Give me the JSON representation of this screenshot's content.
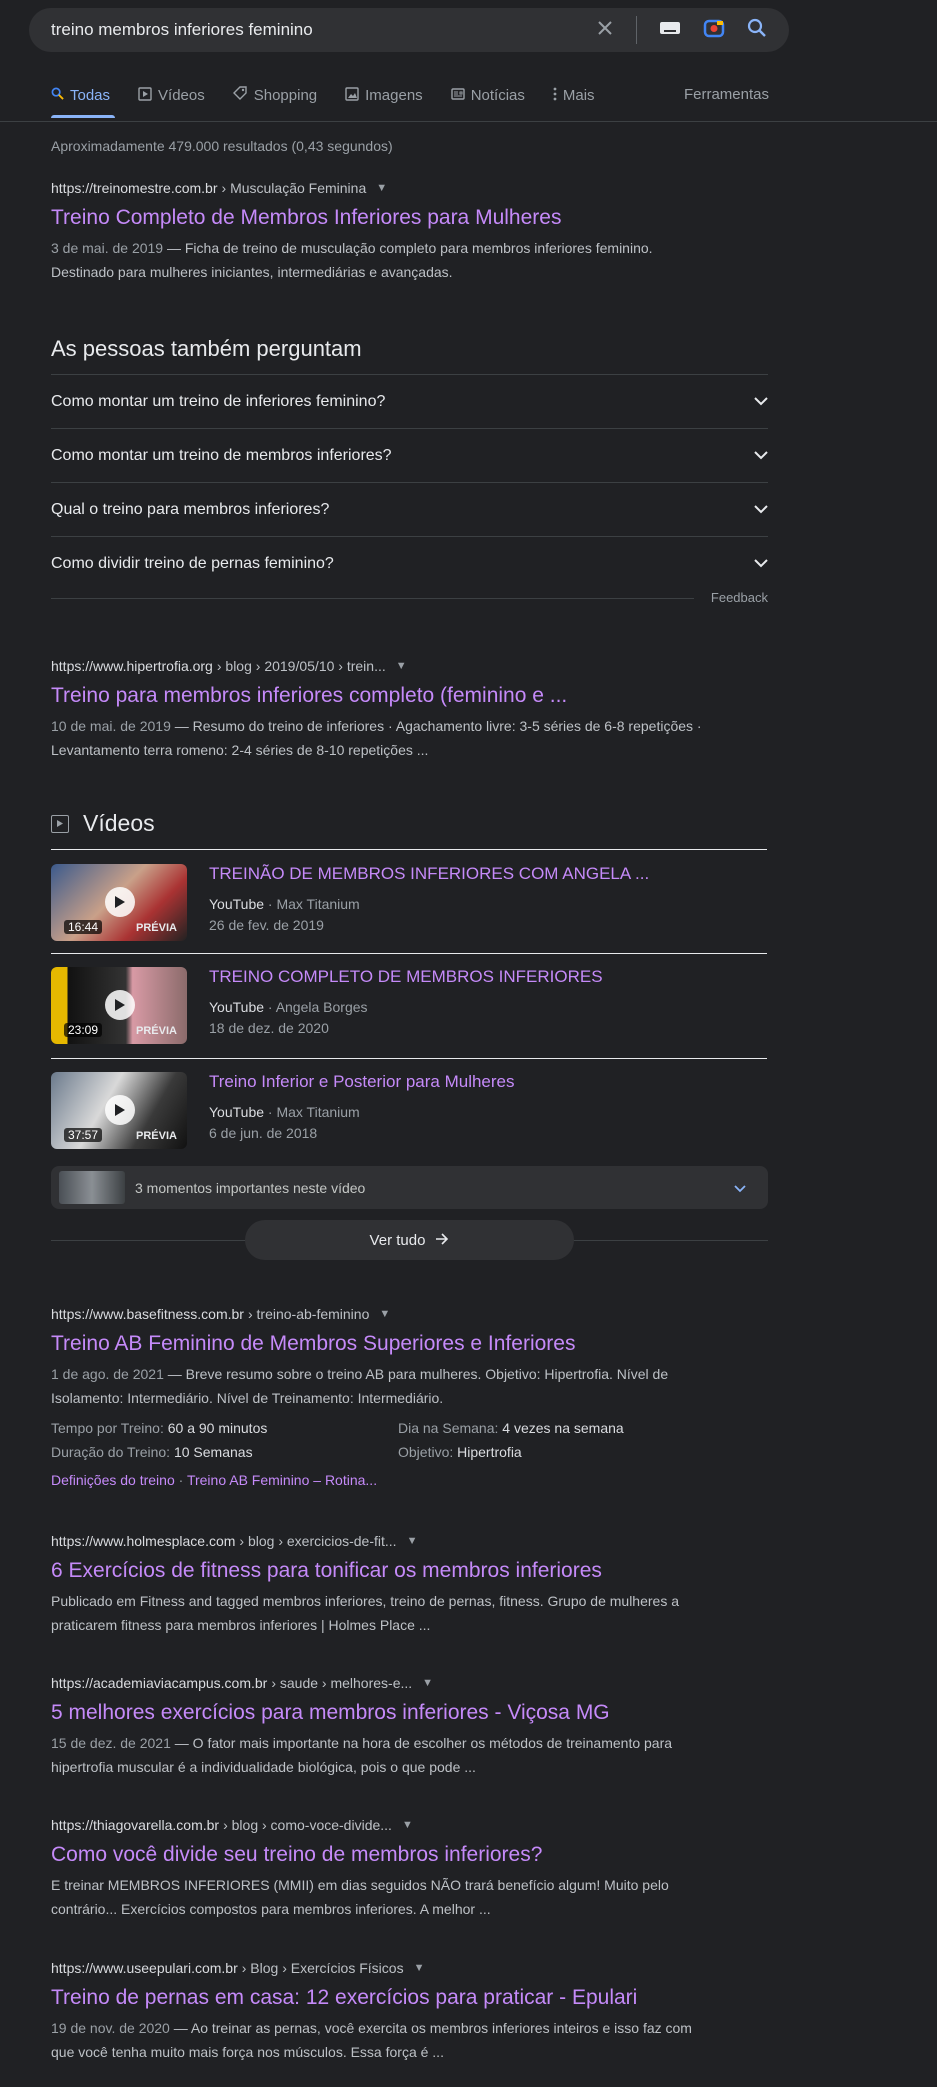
{
  "search": {
    "query": "treino membros inferiores feminino"
  },
  "tabs": [
    {
      "label": "Todas",
      "icon": "search-icon"
    },
    {
      "label": "Vídeos",
      "icon": "video-icon"
    },
    {
      "label": "Shopping",
      "icon": "tag-icon"
    },
    {
      "label": "Imagens",
      "icon": "image-icon"
    },
    {
      "label": "Notícias",
      "icon": "news-icon"
    },
    {
      "label": "Mais",
      "icon": "more-icon"
    }
  ],
  "tools_label": "Ferramentas",
  "stats": "Aproximadamente 479.000 resultados (0,43 segundos)",
  "results": [
    {
      "site": "https://treinomestre.com.br",
      "path": "› Musculação Feminina",
      "title": "Treino Completo de Membros Inferiores para Mulheres",
      "date": "3 de mai. de 2019",
      "snippet": "Ficha de treino de musculação completo para membros inferiores feminino. Destinado para mulheres iniciantes, intermediárias e avançadas."
    },
    {
      "site": "https://www.hipertrofia.org",
      "path": "› blog › 2019/05/10 › trein...",
      "title": "Treino para membros inferiores completo (feminino e ...",
      "date": "10 de mai. de 2019",
      "snippet": "Resumo do treino de inferiores · Agachamento livre: 3-5 séries de 6-8 repetições · Levantamento terra romeno: 2-4 séries de 8-10 repetições ..."
    },
    {
      "site": "https://www.basefitness.com.br",
      "path": "› treino-ab-feminino",
      "title": "Treino AB Feminino de Membros Superiores e Inferiores",
      "date": "1 de ago. de 2021",
      "snippet": "Breve resumo sobre o treino AB para mulheres. Objetivo: Hipertrofia. Nível de Isolamento: Intermediário. Nível de Treinamento: Intermediário.",
      "facts": [
        {
          "k": "Tempo por Treino:",
          "v": "60 a 90 minutos"
        },
        {
          "k": "Dia na Semana:",
          "v": "4 vezes na semana"
        },
        {
          "k": "Duração do Treino:",
          "v": "10 Semanas"
        },
        {
          "k": "Objetivo:",
          "v": "Hipertrofia"
        }
      ],
      "sitelinks": [
        "Definições do treino",
        "Treino AB Feminino – Rotina..."
      ]
    },
    {
      "site": "https://www.holmesplace.com",
      "path": "› blog › exercicios-de-fit...",
      "title": "6 Exercícios de fitness para tonificar os membros inferiores",
      "snippet": "Publicado em Fitness and tagged membros inferiores, treino de pernas, fitness. Grupo de mulheres a praticarem fitness para membros inferiores | Holmes Place ..."
    },
    {
      "site": "https://academiaviacampus.com.br",
      "path": "› saude › melhores-e...",
      "title": "5 melhores exercícios para membros inferiores - Viçosa MG",
      "date": "15 de dez. de 2021",
      "snippet": "O fator mais importante na hora de escolher os métodos de treinamento para hipertrofia muscular é a individualidade biológica, pois o que pode ..."
    },
    {
      "site": "https://thiagovarella.com.br",
      "path": "› blog › como-voce-divide...",
      "title": "Como você divide seu treino de membros inferiores?",
      "snippet": "E treinar MEMBROS INFERIORES (MMII) em dias seguidos NÃO trará benefício algum! Muito pelo contrário... Exercícios compostos para membros inferiores. A melhor ..."
    },
    {
      "site": "https://www.useepulari.com.br",
      "path": "› Blog › Exercícios Físicos",
      "title": "Treino de pernas em casa: 12 exercícios para praticar - Epulari",
      "date": "19 de nov. de 2020",
      "snippet": "Ao treinar as pernas, você exercita os membros inferiores inteiros e isso faz com que você tenha muito mais força nos músculos. Essa força é ..."
    }
  ],
  "paa": {
    "heading": "As pessoas também perguntam",
    "questions": [
      "Como montar um treino de inferiores feminino?",
      "Como montar um treino de membros inferiores?",
      "Qual o treino para membros inferiores?",
      "Como dividir treino de pernas feminino?"
    ],
    "feedback": "Feedback"
  },
  "videos": {
    "heading": "Vídeos",
    "items": [
      {
        "title": "TREINÃO DE MEMBROS INFERIORES COM ANGELA ...",
        "source": "YouTube",
        "channel": "Max Titanium",
        "date": "26 de fev. de 2019",
        "duration": "16:44",
        "tag": "PRÉVIA"
      },
      {
        "title": "TREINO COMPLETO DE MEMBROS INFERIORES",
        "source": "YouTube",
        "channel": "Angela Borges",
        "date": "18 de dez. de 2020",
        "duration": "23:09",
        "tag": "PRÉVIA"
      },
      {
        "title": "Treino Inferior e Posterior para Mulheres",
        "source": "YouTube",
        "channel": "Max Titanium",
        "date": "6 de jun. de 2018",
        "duration": "37:57",
        "tag": "PRÉVIA"
      }
    ],
    "moments": "3 momentos importantes neste vídeo",
    "see_all": "Ver tudo"
  }
}
